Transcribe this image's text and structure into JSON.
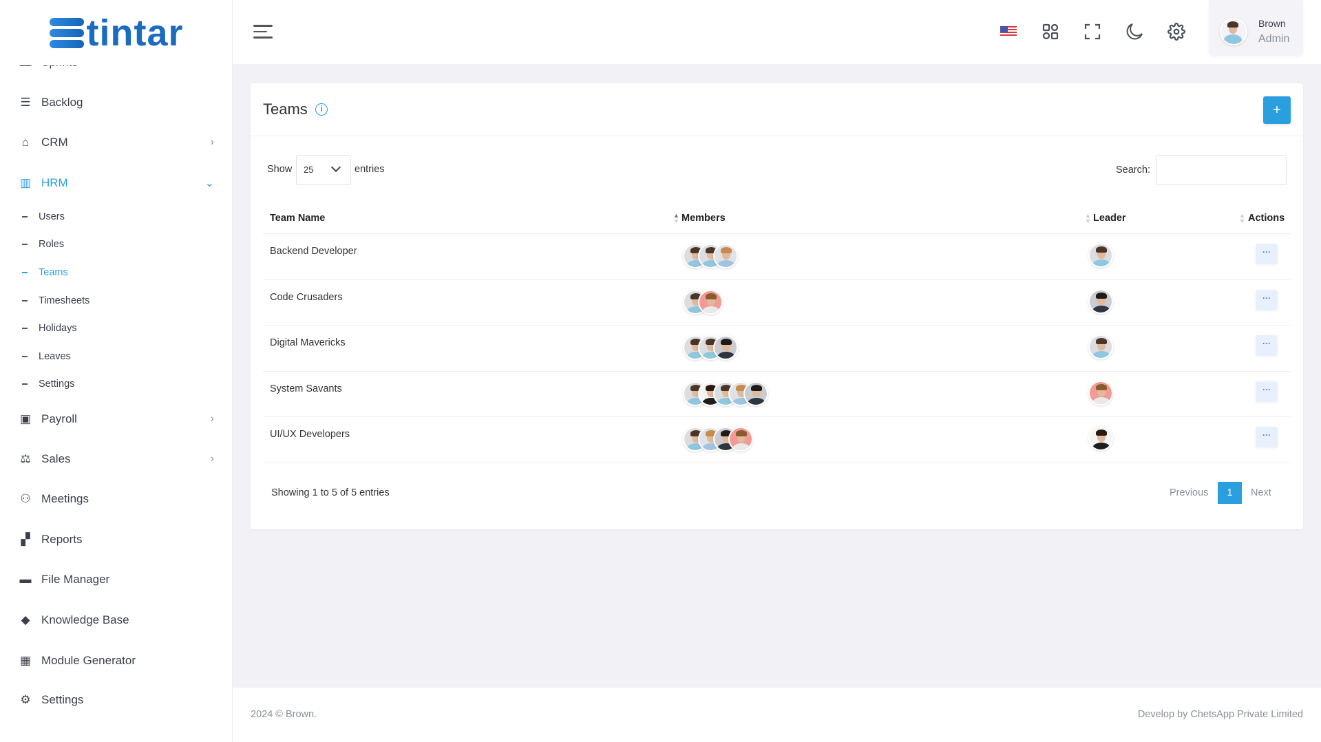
{
  "brand": {
    "name": "tintar",
    "logo_letter": "S"
  },
  "sidebar": {
    "partial_item": "Sprints",
    "items": [
      {
        "label": "Backlog",
        "icon": "backlog-icon",
        "glyph": "☰"
      },
      {
        "label": "CRM",
        "icon": "crm-icon",
        "glyph": "⌂",
        "chevron": "›"
      },
      {
        "label": "HRM",
        "icon": "hrm-icon",
        "glyph": "▥",
        "chevron": "⌄",
        "active": true
      },
      {
        "label": "Payroll",
        "icon": "payroll-icon",
        "glyph": "▣",
        "chevron": "›"
      },
      {
        "label": "Sales",
        "icon": "scale-icon",
        "glyph": "⚖",
        "chevron": "›"
      },
      {
        "label": "Meetings",
        "icon": "meetings-icon",
        "glyph": "⚇"
      },
      {
        "label": "Reports",
        "icon": "reports-icon",
        "glyph": "▞"
      },
      {
        "label": "File Manager",
        "icon": "folder-icon",
        "glyph": "▬"
      },
      {
        "label": "Knowledge Base",
        "icon": "graduation-cap-icon",
        "glyph": "◆"
      },
      {
        "label": "Module Generator",
        "icon": "grid-icon",
        "glyph": "▦"
      },
      {
        "label": "Settings",
        "icon": "gear-icon",
        "glyph": "⚙"
      }
    ],
    "hrm_sub": [
      "Users",
      "Roles",
      "Teams",
      "Timesheets",
      "Holidays",
      "Leaves",
      "Settings"
    ],
    "active_sub": "Teams"
  },
  "header": {
    "user_name": "Brown",
    "user_role": "Admin",
    "icons": [
      "us-flag-icon",
      "apps-icon",
      "fullscreen-icon",
      "moon-icon",
      "gear-icon"
    ]
  },
  "page": {
    "title": "Teams",
    "add_label": "+",
    "show_label": "Show",
    "entries_label": "entries",
    "page_size": "25",
    "search_label": "Search:",
    "search_value": "",
    "columns": [
      "Team Name",
      "Members",
      "Leader",
      "Actions"
    ],
    "rows": [
      {
        "name": "Backend Developer",
        "members": [
          "man-beard",
          "man-beard",
          "woman-blonde"
        ],
        "leader": "man-beard"
      },
      {
        "name": "Code Crusaders",
        "members": [
          "man-beard",
          "man-glasses-red"
        ],
        "leader": "man-dark"
      },
      {
        "name": "Digital Mavericks",
        "members": [
          "man-beard",
          "man-beard",
          "man-dark"
        ],
        "leader": "man-beard"
      },
      {
        "name": "System Savants",
        "members": [
          "man-beard",
          "woman-curly",
          "man-beard",
          "woman-blonde",
          "man-dark"
        ],
        "leader": "man-glasses-red"
      },
      {
        "name": "UI/UX Developers",
        "members": [
          "man-beard",
          "woman-blonde",
          "man-dark",
          "man-glasses-red"
        ],
        "leader": "woman-curly"
      }
    ],
    "action_label": "···",
    "info_text": "Showing 1 to 5 of 5 entries",
    "pagination": {
      "previous": "Previous",
      "current": "1",
      "next": "Next"
    }
  },
  "footer": {
    "left": "2024 © Brown.",
    "right": "Develop by ChetsApp Private Limited"
  },
  "colors": {
    "accent": "#2a9fe0",
    "brand": "#1a6cc0",
    "background": "#f1f1f6"
  }
}
